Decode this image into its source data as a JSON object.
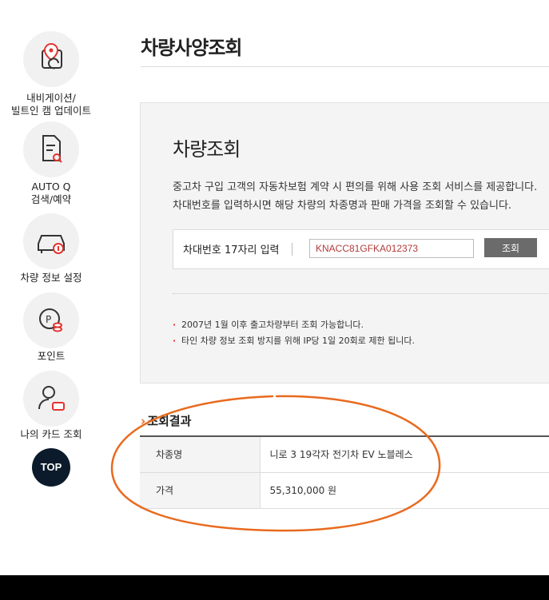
{
  "sidebar": {
    "items": [
      {
        "label": "내비게이션/\n빌트인 캠 업데이트",
        "icon": "map-pin-icon"
      },
      {
        "label": "AUTO Q\n검색/예약",
        "icon": "document-search-icon"
      },
      {
        "label": "차량 정보 설정",
        "icon": "car-info-icon"
      },
      {
        "label": "포인트",
        "icon": "point-coin-icon"
      },
      {
        "label": "나의 카드 조회",
        "icon": "user-card-icon"
      }
    ],
    "top_button": "TOP"
  },
  "page": {
    "title": "차량사양조회"
  },
  "search": {
    "title": "차량조회",
    "desc_line1": "중고차 구입 고객의 자동차보험 계약 시 편의를 위해 사용 조회 서비스를 제공합니다.",
    "desc_line2": "차대번호를 입력하시면 해당 차량의 차종명과 판매 가격을 조회할 수 있습니다.",
    "input_label": "차대번호 17자리 입력",
    "vin_value": "KNACC81GFKA012373",
    "button_label": "조회",
    "notes": [
      "2007년 1월 이후 출고차량부터 조회 가능합니다.",
      "타인 차량 정보 조회 방지를 위해 IP당 1일 20회로 제한 됩니다."
    ]
  },
  "result": {
    "heading": "조회결과",
    "rows": [
      {
        "label": "차종명",
        "value": "니로 3 19각자 전기차 EV 노블레스"
      },
      {
        "label": "가격",
        "value": "55,310,000 원"
      }
    ]
  },
  "colors": {
    "accent_orange": "#e86a1e",
    "sidebar_icon_red": "#e3342f",
    "top_button_bg": "#0b1b2b"
  }
}
